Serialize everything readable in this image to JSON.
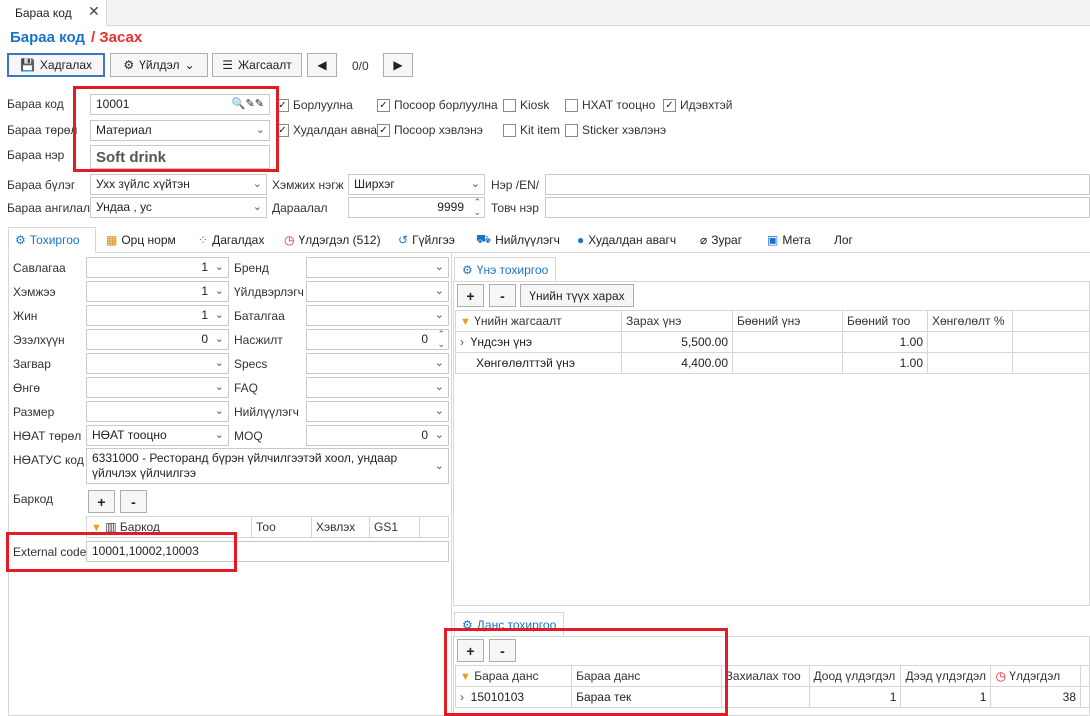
{
  "doc_tab": {
    "title": "Бараа код"
  },
  "page": {
    "title": "Бараа код",
    "subtitle": "/ Засах"
  },
  "toolbar": {
    "save": "Хадгалах",
    "actions": "Үйлдэл",
    "list": "Жагсаалт",
    "position": "0/0"
  },
  "form": {
    "code_label": "Бараа код",
    "code_value": "10001",
    "type_label": "Бараа төрөл",
    "type_value": "Материал",
    "name_label": "Бараа нэр",
    "name_value": "Soft drink",
    "group_label": "Бараа бүлэг",
    "group_value": "Ухх зүйлс хүйтэн",
    "category_label": "Бараа ангилал",
    "category_value": "Ундаа , ус",
    "unit_label": "Хэмжих нэгж",
    "unit_value": "Ширхэг",
    "order_label": "Дараалал",
    "order_value": "9999",
    "name_en_label": "Нэр /EN/",
    "short_name_label": "Товч нэр",
    "checks": [
      {
        "label": "Борлуулна",
        "checked": true
      },
      {
        "label": "Посоор борлуулна",
        "checked": true
      },
      {
        "label": "Kiosk",
        "checked": false
      },
      {
        "label": "НХАТ тооцно",
        "checked": false
      },
      {
        "label": "Идэвхтэй",
        "checked": true
      },
      {
        "label": "Худалдан авна",
        "checked": true
      },
      {
        "label": "Посоор хэвлэнэ",
        "checked": true
      },
      {
        "label": "Kit item",
        "checked": false
      },
      {
        "label": "Sticker хэвлэнэ",
        "checked": false
      }
    ]
  },
  "tabs": [
    {
      "label": "Тохиргоо",
      "icon": "gear-icon"
    },
    {
      "label": "Орц норм",
      "icon": "grid-icon"
    },
    {
      "label": "Дагалдах",
      "icon": "tree-icon"
    },
    {
      "label": "Үлдэгдэл (512)",
      "icon": "clock-icon"
    },
    {
      "label": "Гүйлгээ",
      "icon": "history-icon"
    },
    {
      "label": "Нийлүүлэгч",
      "icon": "truck-icon"
    },
    {
      "label": "Худалдан авагч",
      "icon": "person-icon"
    },
    {
      "label": "Зураг",
      "icon": "paperclip-icon"
    },
    {
      "label": "Мета",
      "icon": "meta-icon"
    },
    {
      "label": "Лог",
      "icon": ""
    }
  ],
  "settings": {
    "savlagaa": "Савлагаа",
    "savlagaa_v": "1",
    "hemjee": "Хэмжээ",
    "hemjee_v": "1",
    "jin": "Жин",
    "jin_v": "1",
    "ezlehuun": "Эзэлхүүн",
    "ezlehuun_v": "0",
    "zagvar": "Загвар",
    "ongo": "Өнгө",
    "razmer": "Размер",
    "vat_type": "НӨАТ төрөл",
    "vat_type_v": "НӨАТ тооцно",
    "vatus": "НӨАТУС код",
    "vatus_v": "6331000 - Ресторанд бүрэн үйлчилгээтэй хоол, ундаар үйлчлэх үйлчилгээ",
    "brand": "Бренд",
    "maker": "Үйлдвэрлэгч",
    "warranty": "Баталгаа",
    "nasjilt": "Насжилт",
    "nasjilt_v": "0",
    "specs": "Specs",
    "faq": "FAQ",
    "supplier": "Нийлүүлэгч",
    "moq": "MOQ",
    "moq_v": "0",
    "barcode": "Баркод",
    "ext_label": "External code",
    "ext_value": "10001,10002,10003",
    "barcode_cols": [
      "Баркод",
      "Тоо",
      "Хэвлэх",
      "GS1"
    ]
  },
  "price": {
    "tab": "Үнэ тохиргоо",
    "history_btn": "Үнийн түүх харах",
    "cols": [
      "Үнийн жагсаалт",
      "Зарах үнэ",
      "Бөөний үнэ",
      "Бөөний тоо",
      "Хөнгөлөлт %"
    ],
    "rows": [
      [
        "Үндсэн үнэ",
        "5,500.00",
        "",
        "1.00",
        ""
      ],
      [
        "Хөнгөлөлттэй үнэ",
        "4,400.00",
        "",
        "1.00",
        ""
      ]
    ]
  },
  "account": {
    "tab": "Данс тохиргоо",
    "cols": [
      "Бараа данс",
      "Бараа данс",
      "Захиалах тоо",
      "Доод үлдэгдэл",
      "Дээд үлдэгдэл",
      "Үлдэгдэл"
    ],
    "rows": [
      [
        "15010103",
        "Бараа тек",
        "",
        "1",
        "1",
        "38"
      ]
    ]
  },
  "colors": {
    "accent": "#1a73c9",
    "red": "#e11c24"
  }
}
